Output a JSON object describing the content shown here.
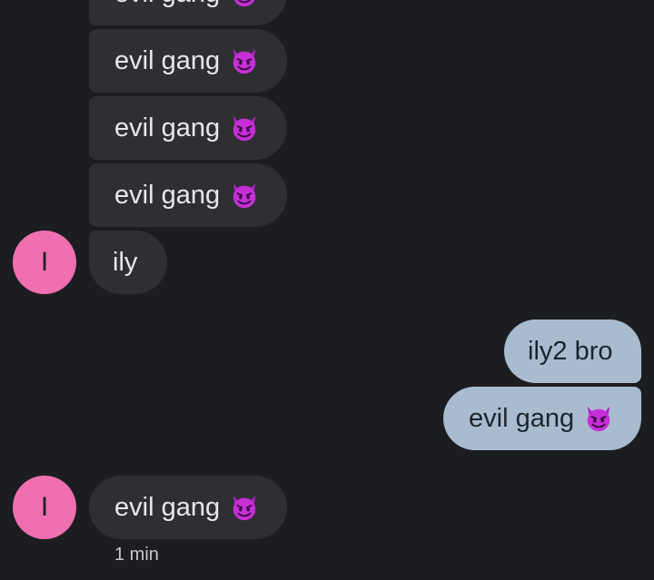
{
  "conversation": {
    "messages": [
      {
        "side": "in",
        "text": "evil gang",
        "emoji": "smiling-face-with-horns-icon"
      },
      {
        "side": "in",
        "text": "evil gang",
        "emoji": "smiling-face-with-horns-icon"
      },
      {
        "side": "in",
        "text": "evil gang",
        "emoji": "smiling-face-with-horns-icon"
      },
      {
        "side": "in",
        "text": "evil gang",
        "emoji": "smiling-face-with-horns-icon"
      },
      {
        "side": "in",
        "text": "ily"
      },
      {
        "side": "out",
        "text": "ily2 bro"
      },
      {
        "side": "out",
        "text": "evil gang",
        "emoji": "smiling-face-with-horns-icon"
      },
      {
        "side": "in",
        "text": "evil gang",
        "emoji": "smiling-face-with-horns-icon"
      }
    ],
    "sender_avatar_initial": "I",
    "last_timestamp": "1 min"
  },
  "colors": {
    "background": "#1c1d20",
    "incoming_bubble": "#2e2f33",
    "outgoing_bubble": "#a9bccf",
    "avatar": "#f06fb0",
    "emoji_purple": "#c72fd6"
  }
}
